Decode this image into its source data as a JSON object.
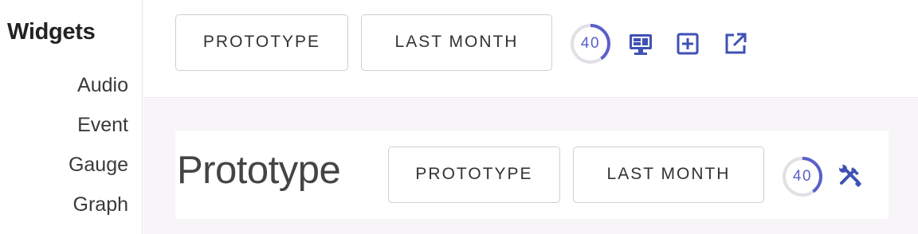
{
  "sidebar": {
    "title": "Widgets",
    "items": [
      {
        "label": "Audio"
      },
      {
        "label": "Event"
      },
      {
        "label": "Gauge"
      },
      {
        "label": "Graph"
      }
    ]
  },
  "toolbar": {
    "prototype_label": "PROTOTYPE",
    "period_label": "LAST MONTH",
    "refresh_value": "40",
    "refresh_fraction": 0.4,
    "icons": {
      "monitor": "desktop-icon",
      "add": "add-box-icon",
      "open": "open-in-new-icon"
    }
  },
  "card": {
    "title": "Prototype",
    "prototype_label": "PROTOTYPE",
    "period_label": "LAST MONTH",
    "refresh_value": "40",
    "refresh_fraction": 0.4,
    "tools_icon": "wrench-screwdriver-icon"
  },
  "colors": {
    "accent": "#5a5fc9",
    "icon_blue": "#3f51b5",
    "ring_track": "#e2dfe5",
    "content_bg": "#f7f5f8"
  }
}
